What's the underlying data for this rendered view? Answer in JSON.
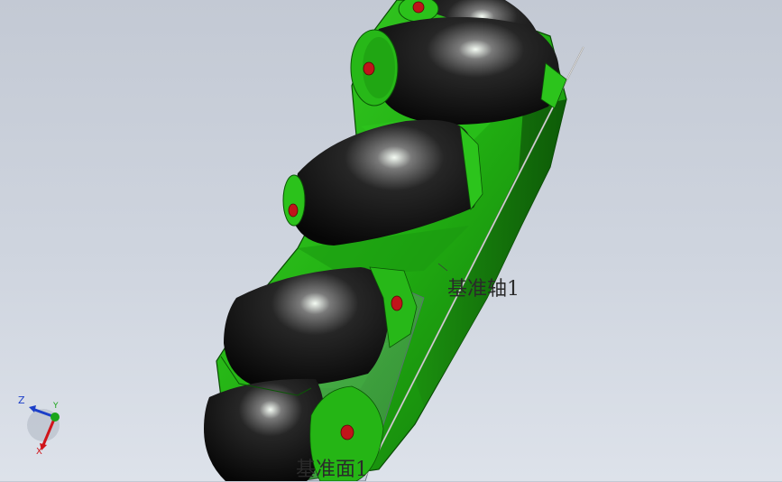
{
  "annotations": {
    "datum_axis": "基准轴1",
    "datum_plane": "基准面1"
  },
  "triad": {
    "z_label": "Z",
    "y_label": "Y",
    "x_label": "X"
  },
  "colors": {
    "frame_green": "#22b814",
    "frame_green_dark": "#0e6a08",
    "roller_black": "#141414",
    "pin_red": "#c0141a",
    "axis_x": "#d0141a",
    "axis_y": "#1aa51a",
    "axis_z": "#1c3fc8"
  },
  "icons": {
    "view_triad": "triad-icon"
  }
}
